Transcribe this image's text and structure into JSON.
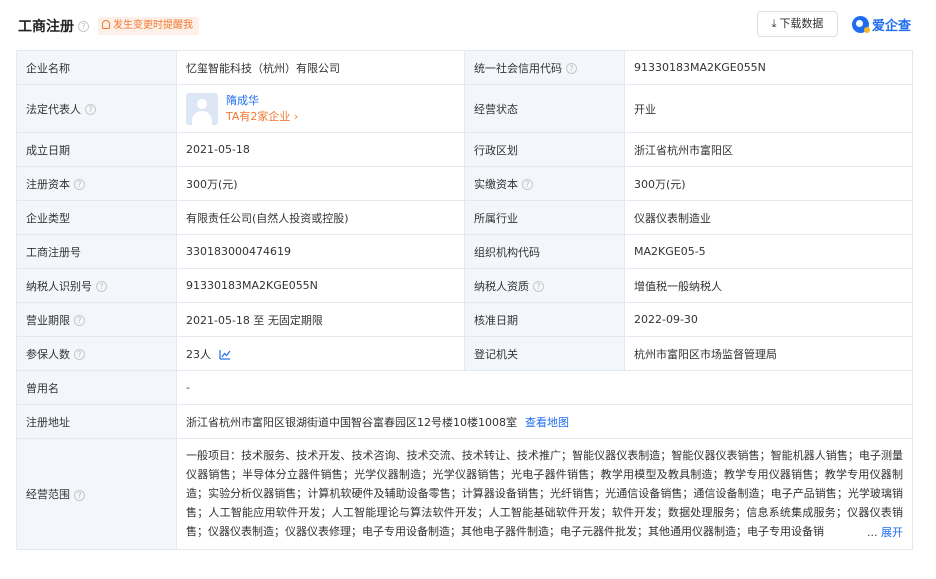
{
  "header": {
    "title": "工商注册",
    "remind_label": "发生变更时提醒我",
    "download_label": "下载数据",
    "brand_name": "爱企查"
  },
  "rows": {
    "company_name": {
      "label": "企业名称",
      "value": "忆玺智能科技（杭州）有限公司"
    },
    "credit_code": {
      "label": "统一社会信用代码",
      "value": "91330183MA2KGE055N"
    },
    "legal_rep": {
      "label": "法定代表人",
      "name": "隋成华",
      "more": "TA有2家企业"
    },
    "status": {
      "label": "经营状态",
      "value": "开业"
    },
    "founded": {
      "label": "成立日期",
      "value": "2021-05-18"
    },
    "region": {
      "label": "行政区划",
      "value": "浙江省杭州市富阳区"
    },
    "reg_capital": {
      "label": "注册资本",
      "value": "300万(元)"
    },
    "paid_capital": {
      "label": "实缴资本",
      "value": "300万(元)"
    },
    "company_type": {
      "label": "企业类型",
      "value": "有限责任公司(自然人投资或控股)"
    },
    "industry": {
      "label": "所属行业",
      "value": "仪器仪表制造业"
    },
    "reg_no": {
      "label": "工商注册号",
      "value": "330183000474619"
    },
    "org_code": {
      "label": "组织机构代码",
      "value": "MA2KGE05-5"
    },
    "tax_id": {
      "label": "纳税人识别号",
      "value": "91330183MA2KGE055N"
    },
    "taxpayer_type": {
      "label": "纳税人资质",
      "value": "增值税一般纳税人"
    },
    "term": {
      "label": "营业期限",
      "value": "2021-05-18 至 无固定期限"
    },
    "approve_date": {
      "label": "核准日期",
      "value": "2022-09-30"
    },
    "insured": {
      "label": "参保人数",
      "value": "23人"
    },
    "authority": {
      "label": "登记机关",
      "value": "杭州市富阳区市场监督管理局"
    },
    "former_name": {
      "label": "曾用名",
      "value": "-"
    },
    "address": {
      "label": "注册地址",
      "value": "浙江省杭州市富阳区银湖街道中国智谷富春园区12号楼10楼1008室",
      "map_link": "查看地图"
    },
    "scope": {
      "label": "经营范围",
      "value": "一般项目：技术服务、技术开发、技术咨询、技术交流、技术转让、技术推广；智能仪器仪表制造；智能仪器仪表销售；智能机器人销售；电子测量仪器销售；半导体分立器件销售；光学仪器制造；光学仪器销售；光电子器件销售；教学用模型及教具制造；教学专用仪器销售；教学专用仪器制造；实验分析仪器销售；计算机软硬件及辅助设备零售；计算器设备销售；光纤销售；光通信设备销售；通信设备制造；电子产品销售；光学玻璃销售；人工智能应用软件开发；人工智能理论与算法软件开发；人工智能基础软件开发；软件开发；数据处理服务；信息系统集成服务；仪器仪表销售；仪器仪表制造；仪器仪表修理；电子专用设备制造；其他电子器件制造；电子元器件批发；其他通用仪器制造；电子专用设备销",
      "expand_label": "展开",
      "ellipsis": "..."
    }
  },
  "colors": {
    "accent": "#1f6cf0",
    "remind": "#f07a33",
    "label_bg": "#f3f6fb",
    "border": "#e4e9f1"
  }
}
